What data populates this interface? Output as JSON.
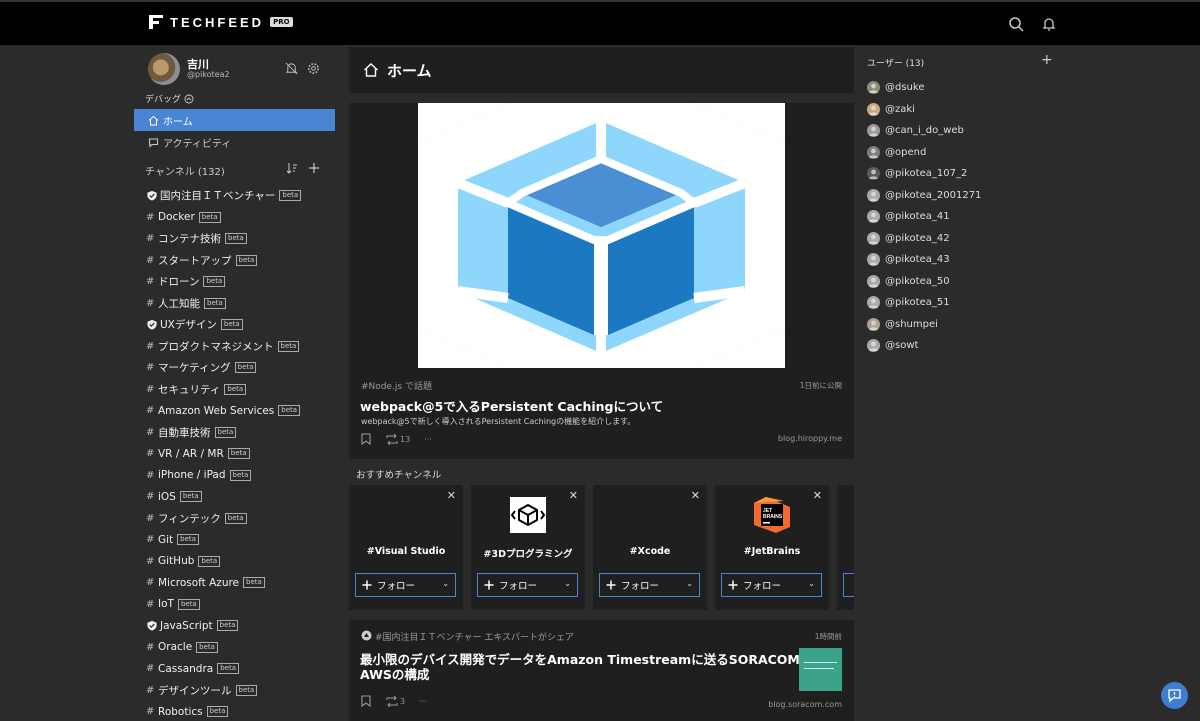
{
  "app": {
    "logo_text": "TECHFEED",
    "logo_badge": "PRO"
  },
  "user": {
    "name": "吉川",
    "handle": "@pikotea2",
    "debug_label": "デバッグ"
  },
  "nav": {
    "home": "ホーム",
    "activity": "アクティビティ"
  },
  "channels": {
    "header": "チャンネル (132)",
    "beta_label": "beta",
    "items": [
      {
        "name": "国内注目ＩＴベンチャー",
        "type": "shield"
      },
      {
        "name": "Docker",
        "type": "hash"
      },
      {
        "name": "コンテナ技術",
        "type": "hash"
      },
      {
        "name": "スタートアップ",
        "type": "hash"
      },
      {
        "name": "ドローン",
        "type": "hash"
      },
      {
        "name": "人工知能",
        "type": "hash"
      },
      {
        "name": "UXデザイン",
        "type": "shield"
      },
      {
        "name": "プロダクトマネジメント",
        "type": "hash"
      },
      {
        "name": "マーケティング",
        "type": "hash"
      },
      {
        "name": "セキュリティ",
        "type": "hash"
      },
      {
        "name": "Amazon Web Services",
        "type": "hash"
      },
      {
        "name": "自動車技術",
        "type": "hash"
      },
      {
        "name": "VR / AR / MR",
        "type": "hash"
      },
      {
        "name": "iPhone / iPad",
        "type": "hash"
      },
      {
        "name": "iOS",
        "type": "hash"
      },
      {
        "name": "フィンテック",
        "type": "hash"
      },
      {
        "name": "Git",
        "type": "hash"
      },
      {
        "name": "GitHub",
        "type": "hash"
      },
      {
        "name": "Microsoft Azure",
        "type": "hash"
      },
      {
        "name": "IoT",
        "type": "hash"
      },
      {
        "name": "JavaScript",
        "type": "shield"
      },
      {
        "name": "Oracle",
        "type": "hash"
      },
      {
        "name": "Cassandra",
        "type": "hash"
      },
      {
        "name": "デザインツール",
        "type": "hash"
      },
      {
        "name": "Robotics",
        "type": "hash"
      }
    ]
  },
  "main": {
    "title": "ホーム",
    "article1": {
      "tag": "#Node.js で話題",
      "time": "1日前に公開",
      "title": "webpack@5で入るPersistent Cachingについて",
      "desc": "webpack@5で新しく導入されるPersistent Cachingの機能を紹介します。",
      "share_count": "13",
      "more": "···",
      "source": "blog.hiroppy.me"
    },
    "recommended": {
      "header": "おすすめチャンネル",
      "follow_label": "フォロー",
      "cards": [
        {
          "name": "#Visual Studio"
        },
        {
          "name": "#3Dプログラミング"
        },
        {
          "name": "#Xcode"
        },
        {
          "name": "#JetBrains"
        }
      ]
    },
    "article2": {
      "tag": "#国内注目ＩＴベンチャー エキスパートがシェア",
      "time": "1時間前",
      "title_line1": "最小限のデバイス開発でデータをAmazon Timestreamに送るSORACOMと",
      "title_line2": "AWSの構成",
      "share_count": "3",
      "more": "···",
      "source": "blog.soracom.com"
    }
  },
  "users": {
    "header": "ユーザー (13)",
    "items": [
      "@dsuke",
      "@zaki",
      "@can_i_do_web",
      "@opend",
      "@pikotea_107_2",
      "@pikotea_2001271",
      "@pikotea_41",
      "@pikotea_42",
      "@pikotea_43",
      "@pikotea_50",
      "@pikotea_51",
      "@shumpei",
      "@sowt"
    ]
  },
  "colors": {
    "accent": "#4a85d3",
    "topbar": "#000000",
    "panel": "#1f1f1f",
    "bg": "#2b2b2b"
  }
}
